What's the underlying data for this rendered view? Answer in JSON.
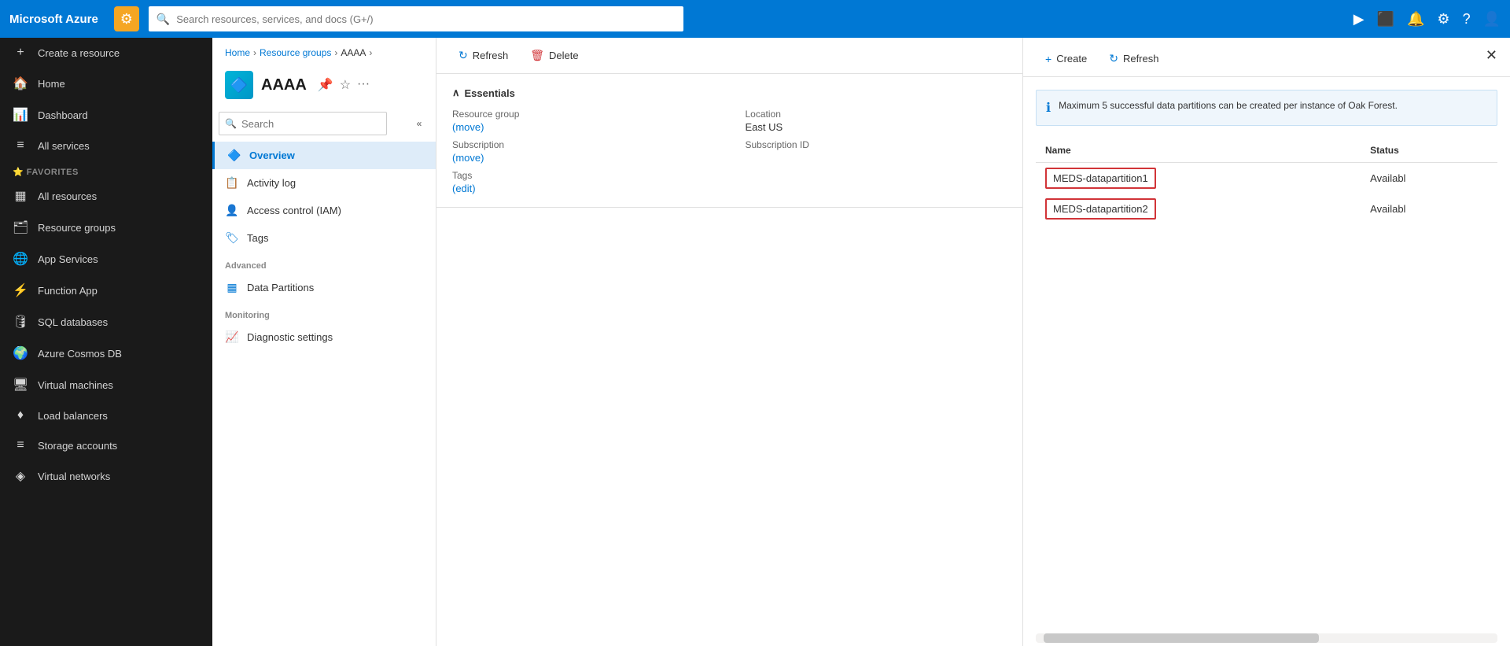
{
  "topnav": {
    "brand": "Microsoft Azure",
    "icon": "⚙",
    "search_placeholder": "Search resources, services, and docs (G+/)",
    "icons": [
      "▶",
      "📋",
      "🔔",
      "⚙",
      "?",
      "👤"
    ]
  },
  "sidebar": {
    "collapse_hint": "«",
    "items": [
      {
        "id": "create",
        "label": "Create a resource",
        "icon": "+"
      },
      {
        "id": "home",
        "label": "Home",
        "icon": "🏠"
      },
      {
        "id": "dashboard",
        "label": "Dashboard",
        "icon": "📊"
      },
      {
        "id": "all-services",
        "label": "All services",
        "icon": "≡"
      },
      {
        "id": "favorites-label",
        "label": "FAVORITES",
        "type": "section"
      },
      {
        "id": "all-resources",
        "label": "All resources",
        "icon": "▦"
      },
      {
        "id": "resource-groups",
        "label": "Resource groups",
        "icon": "🗂"
      },
      {
        "id": "app-services",
        "label": "App Services",
        "icon": "🌐"
      },
      {
        "id": "function-app",
        "label": "Function App",
        "icon": "⚡"
      },
      {
        "id": "sql-databases",
        "label": "SQL databases",
        "icon": "🛢"
      },
      {
        "id": "azure-cosmos",
        "label": "Azure Cosmos DB",
        "icon": "🌍"
      },
      {
        "id": "virtual-machines",
        "label": "Virtual machines",
        "icon": "🖥"
      },
      {
        "id": "load-balancers",
        "label": "Load balancers",
        "icon": "♦"
      },
      {
        "id": "storage-accounts",
        "label": "Storage accounts",
        "icon": "≡"
      },
      {
        "id": "virtual-networks",
        "label": "Virtual networks",
        "icon": "◈"
      }
    ]
  },
  "breadcrumb": {
    "items": [
      "Home",
      "Resource groups",
      "AAAA"
    ],
    "links": [
      true,
      true,
      false
    ]
  },
  "resource": {
    "name": "AAAA",
    "icon": "🔷"
  },
  "nav_search": {
    "placeholder": "Search"
  },
  "nav_items": [
    {
      "id": "overview",
      "label": "Overview",
      "icon": "🔷",
      "selected": true
    },
    {
      "id": "activity-log",
      "label": "Activity log",
      "icon": "📋",
      "selected": false
    },
    {
      "id": "access-control",
      "label": "Access control (IAM)",
      "icon": "👤",
      "selected": false
    },
    {
      "id": "tags",
      "label": "Tags",
      "icon": "🏷",
      "selected": false
    }
  ],
  "nav_sections": [
    {
      "label": "Advanced",
      "items": [
        {
          "id": "data-partitions",
          "label": "Data Partitions",
          "icon": "▦"
        }
      ]
    },
    {
      "label": "Monitoring",
      "items": [
        {
          "id": "diagnostic-settings",
          "label": "Diagnostic settings",
          "icon": "📈"
        }
      ]
    }
  ],
  "toolbar": {
    "refresh_label": "Refresh",
    "delete_label": "Delete"
  },
  "essentials": {
    "header": "Essentials",
    "fields": [
      {
        "label": "Resource group",
        "value": "",
        "link": "move",
        "link_text": "(move)"
      },
      {
        "label": "Location",
        "value": "East US",
        "link": null
      },
      {
        "label": "Subscription",
        "value": "",
        "link": "move",
        "link_text": "(move)"
      },
      {
        "label": "Subscription ID",
        "value": "",
        "link": null
      },
      {
        "label": "Tags",
        "value": "",
        "link": "edit",
        "link_text": "(edit)"
      }
    ]
  },
  "right_panel": {
    "create_label": "Create",
    "refresh_label": "Refresh",
    "info_message": "Maximum 5 successful data partitions can be created per instance of Oak Forest.",
    "table": {
      "columns": [
        "Name",
        "Status"
      ],
      "rows": [
        {
          "name": "MEDS-datapartition1",
          "status": "Availabl",
          "highlighted": true
        },
        {
          "name": "MEDS-datapartition2",
          "status": "Availabl",
          "highlighted": true
        }
      ]
    }
  }
}
